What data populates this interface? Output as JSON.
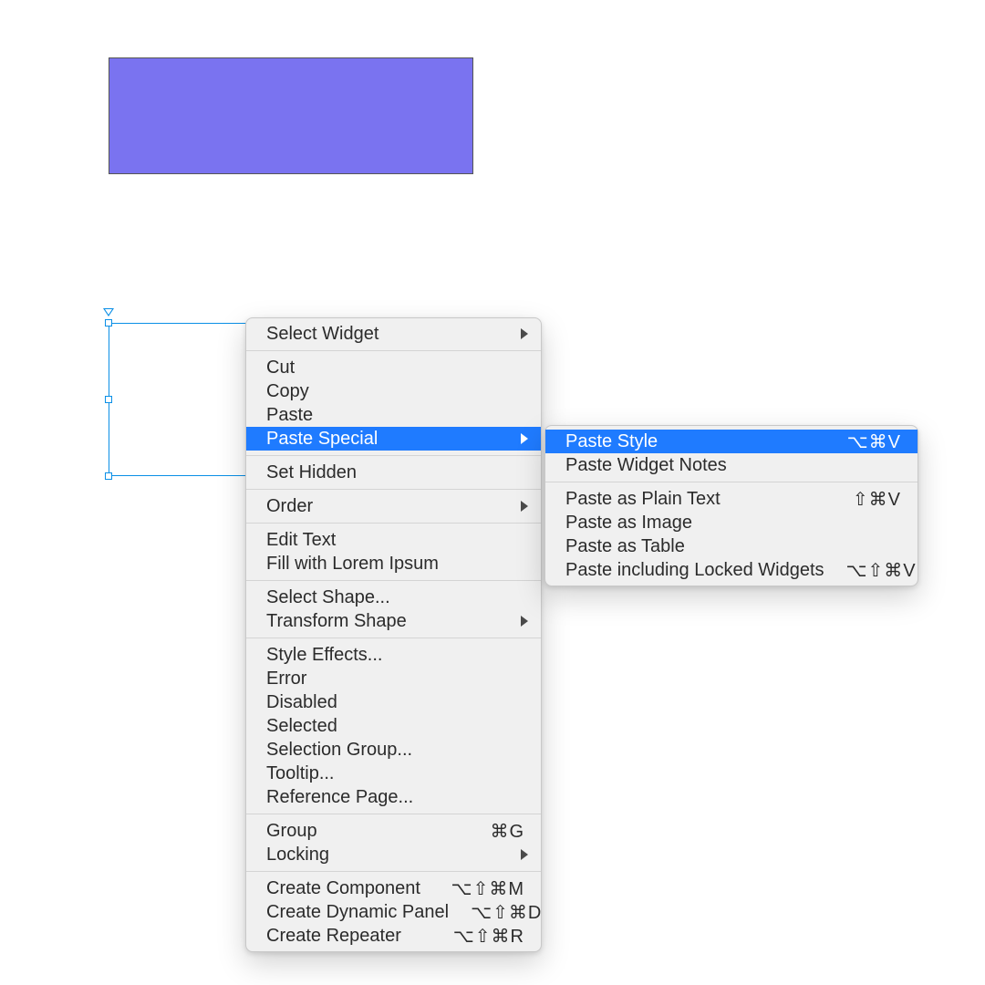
{
  "shapes": {
    "purple_rect_fill": "#7a73f0"
  },
  "context_menu": {
    "select_widget": "Select Widget",
    "cut": "Cut",
    "copy": "Copy",
    "paste": "Paste",
    "paste_special": "Paste Special",
    "set_hidden": "Set Hidden",
    "order": "Order",
    "edit_text": "Edit Text",
    "fill_lorem": "Fill with Lorem Ipsum",
    "select_shape": "Select Shape...",
    "transform_shape": "Transform Shape",
    "style_effects": "Style Effects...",
    "error": "Error",
    "disabled": "Disabled",
    "selected": "Selected",
    "selection_group": "Selection Group...",
    "tooltip": "Tooltip...",
    "reference_page": "Reference Page...",
    "group": "Group",
    "group_shortcut": "⌘G",
    "locking": "Locking",
    "create_component": "Create Component",
    "create_component_shortcut": "⌥⇧⌘M",
    "create_dynamic_panel": "Create Dynamic Panel",
    "create_dynamic_panel_shortcut": "⌥⇧⌘D",
    "create_repeater": "Create Repeater",
    "create_repeater_shortcut": "⌥⇧⌘R"
  },
  "paste_special_submenu": {
    "paste_style": "Paste Style",
    "paste_style_shortcut": "⌥⌘V",
    "paste_widget_notes": "Paste Widget Notes",
    "paste_plain_text": "Paste as Plain Text",
    "paste_plain_text_shortcut": "⇧⌘V",
    "paste_image": "Paste as Image",
    "paste_table": "Paste as Table",
    "paste_locked": "Paste including Locked Widgets",
    "paste_locked_shortcut": "⌥⇧⌘V"
  }
}
